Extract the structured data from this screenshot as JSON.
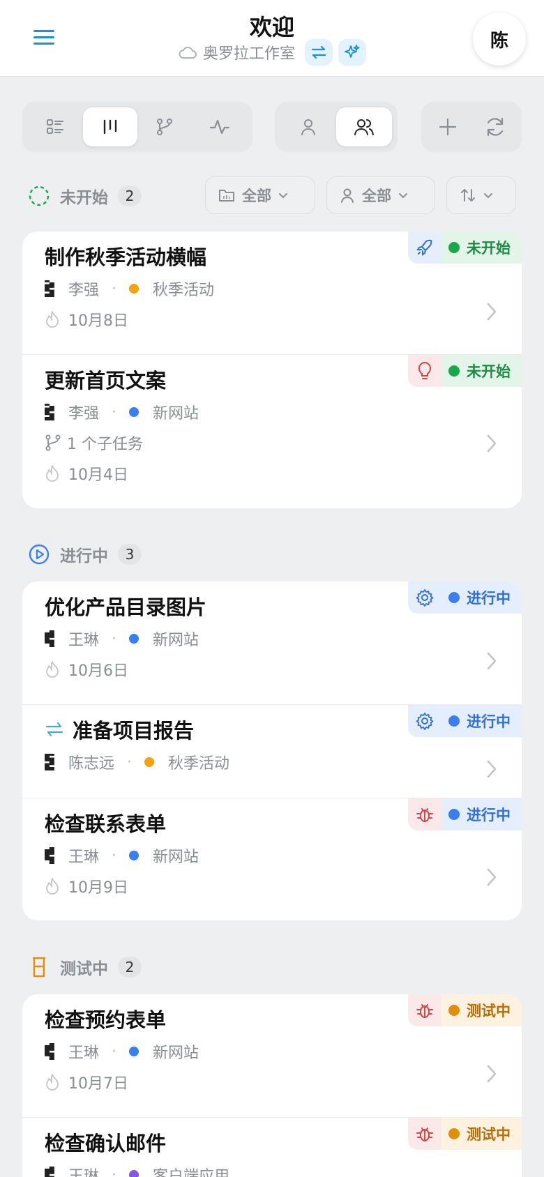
{
  "header": {
    "title": "欢迎",
    "workspace": "奥罗拉工作室",
    "avatar_initial": "陈"
  },
  "filters": {
    "project": "全部",
    "assignee": "全部"
  },
  "colors": {
    "accent": "#1a8fd8",
    "not_started": "#1aa64a",
    "in_progress": "#3a7ff0",
    "testing": "#e28e0a"
  },
  "groups": [
    {
      "label": "未开始",
      "count": "2",
      "tasks": [
        {
          "title": "制作秋季活动横幅",
          "assignee": "李强",
          "project": "秋季活动",
          "project_color": "#f5a20f",
          "date": "10月8日",
          "status": "未开始",
          "icon": "rocket-icon"
        },
        {
          "title": "更新首页文案",
          "assignee": "李强",
          "project": "新网站",
          "project_color": "#3a7ff0",
          "subtasks": "1 个子任务",
          "date": "10月4日",
          "status": "未开始",
          "icon": "lightbulb-icon"
        }
      ]
    },
    {
      "label": "进行中",
      "count": "3",
      "tasks": [
        {
          "title": "优化产品目录图片",
          "assignee": "王琳",
          "project": "新网站",
          "project_color": "#3a7ff0",
          "date": "10月6日",
          "status": "进行中",
          "icon": "gear-icon"
        },
        {
          "title": "准备项目报告",
          "assignee": "陈志远",
          "project": "秋季活动",
          "project_color": "#f5a20f",
          "status": "进行中",
          "icon": "gear-icon",
          "recurring": true
        },
        {
          "title": "检查联系表单",
          "assignee": "王琳",
          "project": "新网站",
          "project_color": "#3a7ff0",
          "date": "10月9日",
          "status": "进行中",
          "icon": "bug-icon"
        }
      ]
    },
    {
      "label": "测试中",
      "count": "2",
      "tasks": [
        {
          "title": "检查预约表单",
          "assignee": "王琳",
          "project": "新网站",
          "project_color": "#3a7ff0",
          "date": "10月7日",
          "status": "测试中",
          "icon": "bug-icon"
        },
        {
          "title": "检查确认邮件",
          "assignee": "王琳",
          "project": "客户端应用",
          "project_color": "#8b55e6",
          "status": "测试中",
          "icon": "bug-icon"
        }
      ]
    }
  ]
}
